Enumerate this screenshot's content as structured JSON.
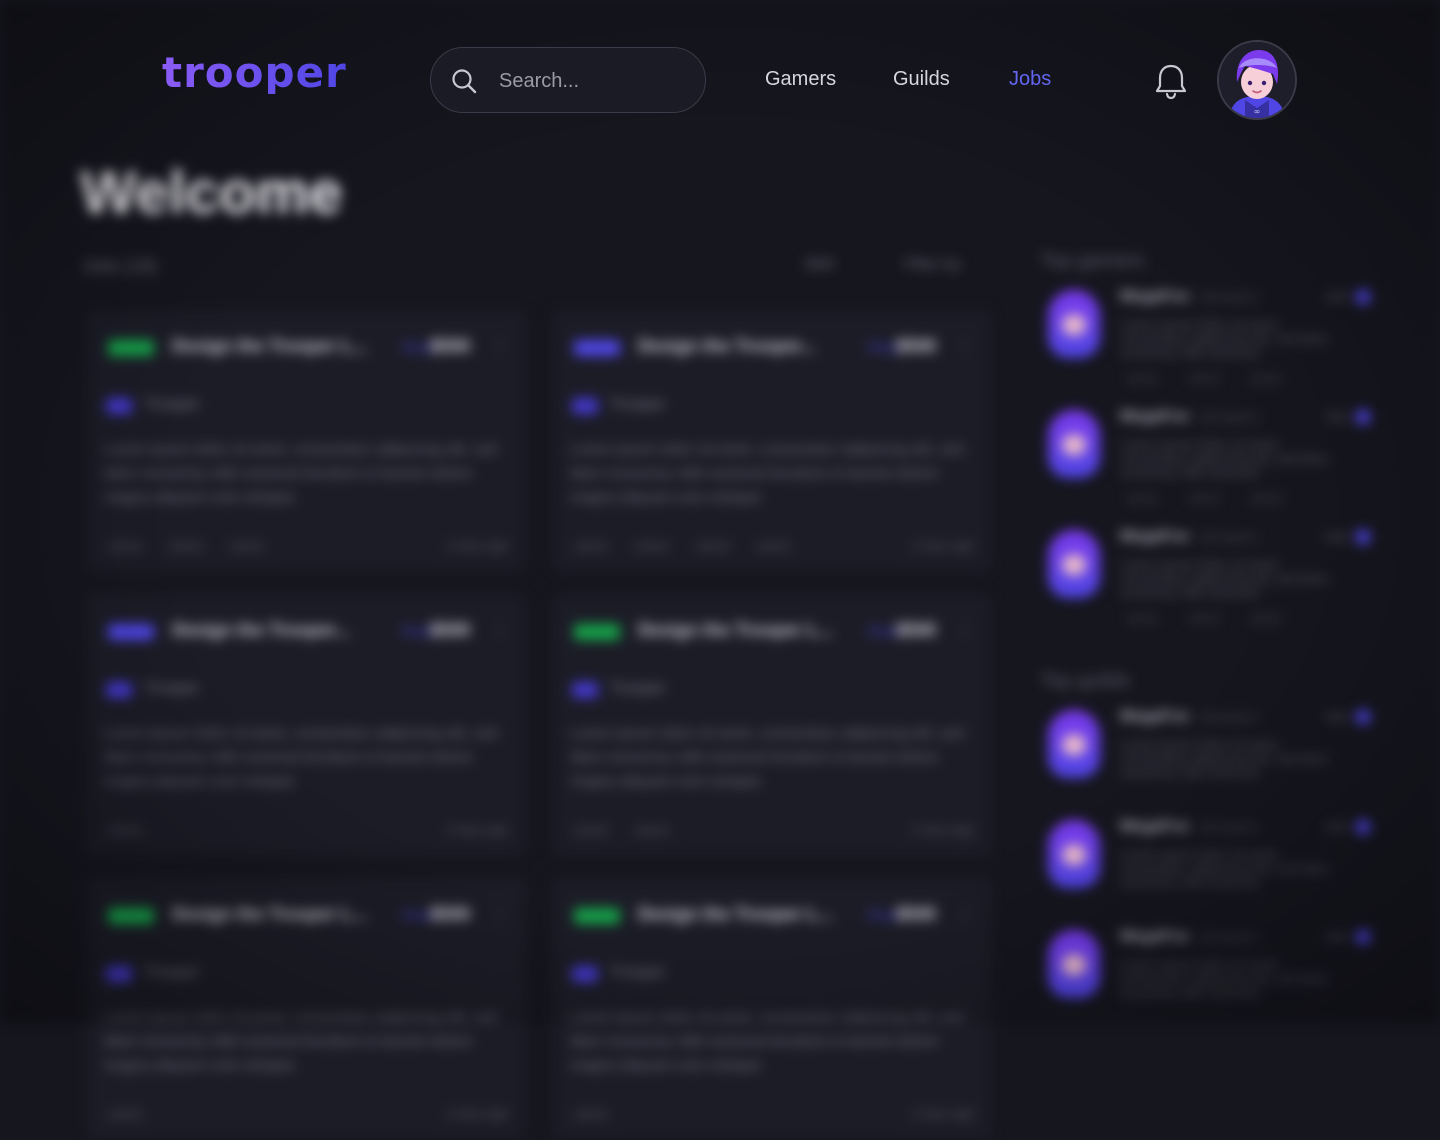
{
  "app": {
    "logo_text": "trooper"
  },
  "header": {
    "search_placeholder": "Search...",
    "nav": [
      {
        "label": "Gamers",
        "active": false
      },
      {
        "label": "Guilds",
        "active": false
      },
      {
        "label": "Jobs",
        "active": true
      }
    ],
    "icons": {
      "search": "search-icon",
      "notifications": "bell-icon",
      "avatar": "user-avatar"
    },
    "accent_color": "#6366f1"
  },
  "main": {
    "title": "Welcome",
    "jobs_label": "Jobs (19)",
    "filters": [
      "Skill",
      "Filter by"
    ],
    "jobs": [
      {
        "tag_color": "#16a34a",
        "title": "Design the Trooper L...",
        "price_label": "Price",
        "price": "$500",
        "org": "Trooper",
        "description": "Lorem ipsum dolor sit amet, consectetur adipiscing elit, sed diam nonummy nibh euismod tincidunt ut laoreet dolore magna aliquam erat volutpat.",
        "tags": [
          "UI/UX",
          "UI/UX",
          "UI/UX"
        ],
        "time": "1 hour ago"
      },
      {
        "tag_color": "#4f46e5",
        "title": "Design the Trooper...",
        "price_label": "Price",
        "price": "$500",
        "org": "Trooper",
        "description": "Lorem ipsum dolor sit amet, consectetur adipiscing elit, sed diam nonummy nibh euismod tincidunt ut laoreet dolore magna aliquam erat volutpat.",
        "tags": [
          "UI/UX",
          "UI/UX",
          "UI/UX",
          "UI/UX"
        ],
        "time": "1 hour ago"
      },
      {
        "tag_color": "#4f46e5",
        "title": "Design the Trooper...",
        "price_label": "Price",
        "price": "$500",
        "org": "Trooper",
        "description": "Lorem ipsum dolor sit amet, consectetur adipiscing elit, sed diam nonummy nibh euismod tincidunt ut laoreet dolore magna aliquam erat volutpat.",
        "tags": [
          "UI/UX"
        ],
        "time": "1 hour ago"
      },
      {
        "tag_color": "#16a34a",
        "title": "Design the Trooper L...",
        "price_label": "Price",
        "price": "$500",
        "org": "Trooper",
        "description": "Lorem ipsum dolor sit amet, consectetur adipiscing elit, sed diam nonummy nibh euismod tincidunt ut laoreet dolore magna aliquam erat volutpat.",
        "tags": [
          "UI/UX",
          "UI/UX"
        ],
        "time": "1 hour ago"
      },
      {
        "tag_color": "#16a34a",
        "title": "Design the Trooper L...",
        "price_label": "Price",
        "price": "$500",
        "org": "Trooper",
        "description": "Lorem ipsum dolor sit amet, consectetur adipiscing elit, sed diam nonummy nibh euismod tincidunt ut laoreet dolore magna aliquam erat volutpat.",
        "tags": [
          "UI/UX"
        ],
        "time": "1 hour ago"
      },
      {
        "tag_color": "#16a34a",
        "title": "Design the Trooper L...",
        "price_label": "Price",
        "price": "$500",
        "org": "Trooper",
        "description": "Lorem ipsum dolor sit amet, consectetur adipiscing elit, sed diam nonummy nibh euismod tincidunt ut laoreet dolore magna aliquam erat volutpat.",
        "tags": [
          "UI/UX"
        ],
        "time": "1 hour ago"
      }
    ]
  },
  "sidebar": {
    "sections": [
      {
        "title": "Top gamers",
        "items": [
          {
            "name": "MegaFox",
            "sub": "@megafox",
            "action": "Add",
            "text": "Lorem ipsum dolor sit amet, consectetur adipiscing elit, sed diam nonummy nibh euismod.",
            "tags": [
              "UI/UX",
              "UI/UX",
              "UI/UX"
            ]
          },
          {
            "name": "MegaFox",
            "sub": "@megafox",
            "action": "Add",
            "text": "Lorem ipsum dolor sit amet, consectetur adipiscing elit, sed diam nonummy nibh euismod.",
            "tags": [
              "UI/UX",
              "UI/UX",
              "UI/UX"
            ]
          },
          {
            "name": "MegaFox",
            "sub": "@megafox",
            "action": "Add",
            "text": "Lorem ipsum dolor sit amet, consectetur adipiscing elit, sed diam nonummy nibh euismod.",
            "tags": [
              "UI/UX",
              "UI/UX",
              "UI/UX"
            ]
          }
        ]
      },
      {
        "title": "Top guilds",
        "items": [
          {
            "name": "MegaFox",
            "sub": "@megafox",
            "action": "Add",
            "text": "Lorem ipsum dolor sit amet, consectetur adipiscing elit, sed diam nonummy nibh euismod.",
            "tags": []
          },
          {
            "name": "MegaFox",
            "sub": "@megafox",
            "action": "Add",
            "text": "Lorem ipsum dolor sit amet, consectetur adipiscing elit, sed diam nonummy nibh euismod.",
            "tags": []
          },
          {
            "name": "MegaFox",
            "sub": "@megafox",
            "action": "Add",
            "text": "Lorem ipsum dolor sit amet, consectetur adipiscing elit, sed diam nonummy nibh euismod.",
            "tags": []
          }
        ]
      }
    ]
  }
}
